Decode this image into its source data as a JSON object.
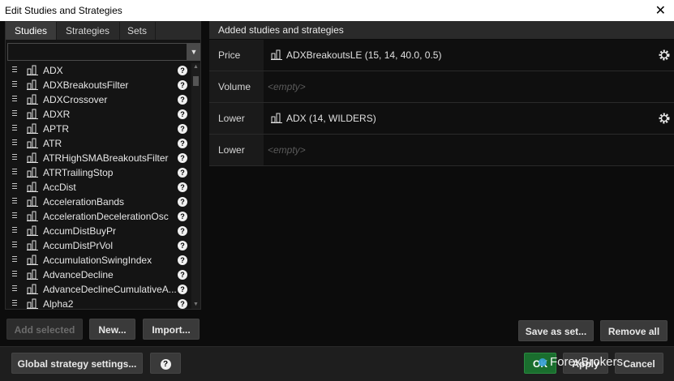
{
  "window": {
    "title": "Edit Studies and Strategies",
    "close_glyph": "✕"
  },
  "tabs": [
    {
      "label": "Studies",
      "active": true
    },
    {
      "label": "Strategies",
      "active": false
    },
    {
      "label": "Sets",
      "active": false
    }
  ],
  "filter": {
    "value": "",
    "placeholder": ""
  },
  "studies": [
    {
      "label": "ADX",
      "icon": "study-icon"
    },
    {
      "label": "ADXBreakoutsFilter",
      "icon": "study-icon"
    },
    {
      "label": "ADXCrossover",
      "icon": "study-icon"
    },
    {
      "label": "ADXR",
      "icon": "study-icon"
    },
    {
      "label": "APTR",
      "icon": "study-icon"
    },
    {
      "label": "ATR",
      "icon": "study-icon"
    },
    {
      "label": "ATRHighSMABreakoutsFilter",
      "icon": "study-icon"
    },
    {
      "label": "ATRTrailingStop",
      "icon": "study-icon"
    },
    {
      "label": "AccDist",
      "icon": "study-icon"
    },
    {
      "label": "AccelerationBands",
      "icon": "study-icon"
    },
    {
      "label": "AccelerationDecelerationOsc",
      "icon": "study-icon"
    },
    {
      "label": "AccumDistBuyPr",
      "icon": "study-icon"
    },
    {
      "label": "AccumDistPrVol",
      "icon": "study-icon"
    },
    {
      "label": "AccumulationSwingIndex",
      "icon": "study-icon"
    },
    {
      "label": "AdvanceDecline",
      "icon": "study-icon"
    },
    {
      "label": "AdvanceDeclineCumulativeA...",
      "icon": "study-icon"
    },
    {
      "label": "Alpha2",
      "icon": "study-icon"
    }
  ],
  "help_glyph": "?",
  "left_buttons": {
    "add_selected": "Add selected",
    "new": "New...",
    "import": "Import..."
  },
  "right": {
    "header": "Added studies and strategies",
    "slots": [
      {
        "name": "Price",
        "content": "ADXBreakoutsLE (15, 14, 40.0, 0.5)",
        "empty": false
      },
      {
        "name": "Volume",
        "content": "<empty>",
        "empty": true
      },
      {
        "name": "Lower",
        "content": "ADX (14, WILDERS)",
        "empty": false
      },
      {
        "name": "Lower",
        "content": "<empty>",
        "empty": true
      }
    ],
    "save_as_set": "Save as set...",
    "remove_all": "Remove all"
  },
  "footer": {
    "global_settings": "Global strategy settings...",
    "help": "?",
    "ok": "OK",
    "apply": "Apply",
    "cancel": "Cancel"
  },
  "watermark": {
    "text": "ForexBrokers",
    "accent": "#3aa0d8"
  },
  "colors": {
    "background": "#0c0c0c",
    "panel": "#141414",
    "header": "#2a2a2a",
    "button": "#3a3a3a",
    "ok_button": "#1a6e2e"
  }
}
